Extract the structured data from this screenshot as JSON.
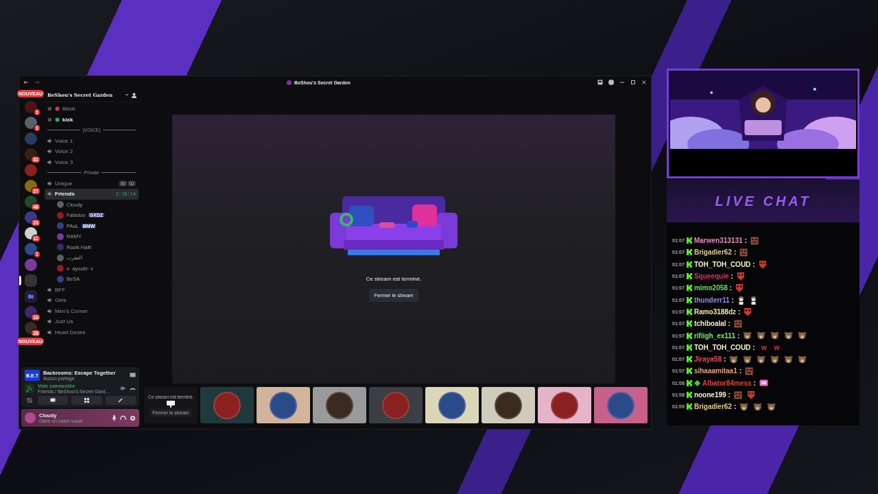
{
  "window": {
    "title": "BeShou's Secret Garden"
  },
  "server_header": {
    "name": "BeShou's Secret Garden"
  },
  "servers": [
    {
      "kind": "pill",
      "label": "NOUVEAU",
      "selected": false
    },
    {
      "kind": "server",
      "badge": "1",
      "selected": false
    },
    {
      "kind": "server",
      "badge": "1",
      "selected": false
    },
    {
      "kind": "server",
      "selected": false
    },
    {
      "kind": "server",
      "badge": "31",
      "selected": false
    },
    {
      "kind": "server",
      "selected": false
    },
    {
      "kind": "server",
      "badge": "27",
      "selected": false
    },
    {
      "kind": "server",
      "badge": "48",
      "selected": false
    },
    {
      "kind": "server",
      "badge": "23",
      "selected": false
    },
    {
      "kind": "server",
      "badge": "11",
      "selected": false
    },
    {
      "kind": "server",
      "badge": "1",
      "selected": false
    },
    {
      "kind": "server",
      "selected": false
    },
    {
      "kind": "server",
      "selected": true
    },
    {
      "kind": "folder",
      "selected": false
    },
    {
      "kind": "server",
      "badge": "10",
      "selected": false
    },
    {
      "kind": "server",
      "badge": "28",
      "selected": false
    },
    {
      "kind": "pill",
      "label": "NOUVEAU",
      "selected": false
    }
  ],
  "channels": [
    {
      "kind": "text",
      "name": "tiktok",
      "unread": false
    },
    {
      "kind": "text",
      "name": "kick",
      "unread": true
    },
    {
      "kind": "category",
      "name": "|VOICE|"
    },
    {
      "kind": "voice",
      "name": "Voice 1",
      "selected": false
    },
    {
      "kind": "voice",
      "name": "Voice 2",
      "selected": false
    },
    {
      "kind": "voice",
      "name": "Voice 3",
      "selected": false
    },
    {
      "kind": "category",
      "name": "Private"
    },
    {
      "kind": "voice",
      "name": "Unique",
      "selected": false,
      "limit": [
        "00",
        "02"
      ]
    },
    {
      "kind": "voice",
      "name": "Friends",
      "selected": true,
      "timer": "2:16:14",
      "members": [
        {
          "name": "Cloudy"
        },
        {
          "name": "Fafadoo",
          "tag": "GXDZ"
        },
        {
          "name": "PAuL",
          "tag": "BMW"
        },
        {
          "name": "RAMY"
        },
        {
          "name": "Razik Haifi"
        },
        {
          "name": "العقرب"
        },
        {
          "name": "x· ayoubi· x"
        },
        {
          "name": "BeSA"
        }
      ]
    },
    {
      "kind": "voice",
      "name": "BFF",
      "selected": false
    },
    {
      "kind": "voice",
      "name": "Girls",
      "selected": false
    },
    {
      "kind": "voice",
      "name": "Men's Corner",
      "selected": false
    },
    {
      "kind": "voice",
      "name": "Just Us",
      "selected": false
    },
    {
      "kind": "voice",
      "name": "Heart Desire",
      "selected": false
    }
  ],
  "activity": {
    "logo": "B.E.T",
    "title": "Backrooms: Escape Together",
    "subtitle": "Aucun partage"
  },
  "voice_status": {
    "status": "Voix connectée",
    "channel": "Friends / BeShou's Secret Gard…"
  },
  "user": {
    "name": "Cloudy",
    "status": "Dans un salon vocal"
  },
  "stage": {
    "message": "Ce stream est terminé.",
    "button": "Fermer le stream"
  },
  "tiles": [
    {
      "kind": "ended",
      "message": "Ce stream est terminé.",
      "button": "Fermer le stream"
    },
    {
      "kind": "avatar",
      "color": "#1f3a3c"
    },
    {
      "kind": "avatar",
      "color": "#d2b49a"
    },
    {
      "kind": "avatar",
      "color": "#9a9a9a"
    },
    {
      "kind": "avatar",
      "color": "#3b3e44"
    },
    {
      "kind": "avatar",
      "color": "#dcd6b8"
    },
    {
      "kind": "avatar",
      "color": "#d0ccbc"
    },
    {
      "kind": "avatar",
      "color": "#e6b4c8"
    },
    {
      "kind": "avatar",
      "color": "#c8608c"
    }
  ],
  "chat": {
    "title": "LIVE CHAT",
    "messages": [
      {
        "time": "01:07",
        "badges": [
          {
            "kind": "kick"
          }
        ],
        "name": "Marwen313131",
        "color": "#e58bc0",
        "sep": ":",
        "parts": [
          {
            "kind": "block"
          }
        ]
      },
      {
        "time": "01:07",
        "badges": [
          {
            "kind": "kick"
          }
        ],
        "name": "Brigadier62",
        "color": "#e2c98c",
        "sep": ":",
        "parts": [
          {
            "kind": "block"
          }
        ]
      },
      {
        "time": "01:07",
        "badges": [
          {
            "kind": "kick"
          }
        ],
        "name": "TOH_TOH_COUD",
        "color": "#f2f2c4",
        "sep": ":",
        "parts": [
          {
            "kind": "mask"
          }
        ]
      },
      {
        "time": "01:07",
        "badges": [
          {
            "kind": "kick"
          }
        ],
        "name": "Squeequie",
        "color": "#e0306a",
        "sep": ":",
        "parts": [
          {
            "kind": "mask"
          }
        ]
      },
      {
        "time": "01:07",
        "badges": [
          {
            "kind": "kick"
          }
        ],
        "name": "mimo2058",
        "color": "#60e060",
        "sep": ":",
        "parts": [
          {
            "kind": "mask"
          }
        ]
      },
      {
        "time": "01:07",
        "badges": [
          {
            "kind": "kick"
          }
        ],
        "name": "thunderr11",
        "color": "#9a8ae8",
        "sep": ":",
        "parts": [
          {
            "kind": "chibi"
          },
          {
            "kind": "chibi"
          }
        ]
      },
      {
        "time": "01:07",
        "badges": [
          {
            "kind": "kick"
          }
        ],
        "name": "Ramo3188dz",
        "color": "#f0e8a0",
        "sep": ":",
        "parts": [
          {
            "kind": "mask"
          }
        ]
      },
      {
        "time": "01:07",
        "badges": [
          {
            "kind": "kick"
          }
        ],
        "name": "tchiboalal",
        "color": "#f0f0c8",
        "sep": ":",
        "parts": [
          {
            "kind": "block"
          }
        ]
      },
      {
        "time": "01:07",
        "badges": [
          {
            "kind": "kick"
          }
        ],
        "name": "rifiigh_ex111",
        "color": "#70f070",
        "sep": ":",
        "parts": [
          {
            "kind": "bear"
          },
          {
            "kind": "bear"
          },
          {
            "kind": "bear"
          },
          {
            "kind": "bear"
          },
          {
            "kind": "bear"
          }
        ]
      },
      {
        "time": "01:07",
        "badges": [
          {
            "kind": "kick"
          }
        ],
        "name": "TOH_TOH_COUD",
        "color": "#f2f2c4",
        "sep": ":",
        "parts": [
          {
            "kind": "text",
            "text": "w"
          },
          {
            "kind": "text",
            "text": "w"
          }
        ]
      },
      {
        "time": "01:07",
        "badges": [
          {
            "kind": "kick"
          }
        ],
        "name": "Jiraya58",
        "color": "#e05050",
        "sep": ":",
        "parts": [
          {
            "kind": "bear"
          },
          {
            "kind": "bear"
          },
          {
            "kind": "bear"
          },
          {
            "kind": "bear"
          },
          {
            "kind": "bear"
          },
          {
            "kind": "bear"
          }
        ]
      },
      {
        "time": "01:07",
        "badges": [
          {
            "kind": "kick"
          }
        ],
        "name": "sihaaamitaa1",
        "color": "#e0a080",
        "sep": ":",
        "parts": [
          {
            "kind": "block"
          }
        ]
      },
      {
        "time": "01:08",
        "badges": [
          {
            "kind": "kick"
          },
          {
            "kind": "gem"
          }
        ],
        "name": "Albator84mess",
        "color": "#e04040",
        "sep": ":",
        "parts": [
          {
            "kind": "tag"
          }
        ]
      },
      {
        "time": "01:08",
        "badges": [
          {
            "kind": "kick"
          }
        ],
        "name": "noone199",
        "color": "#f2f2d8",
        "sep": ":",
        "parts": [
          {
            "kind": "block"
          },
          {
            "kind": "mask"
          }
        ]
      },
      {
        "time": "01:09",
        "badges": [
          {
            "kind": "kick"
          }
        ],
        "name": "Brigadier62",
        "color": "#e2c98c",
        "sep": ":",
        "parts": [
          {
            "kind": "bear"
          },
          {
            "kind": "bear"
          },
          {
            "kind": "bear"
          }
        ]
      }
    ]
  }
}
